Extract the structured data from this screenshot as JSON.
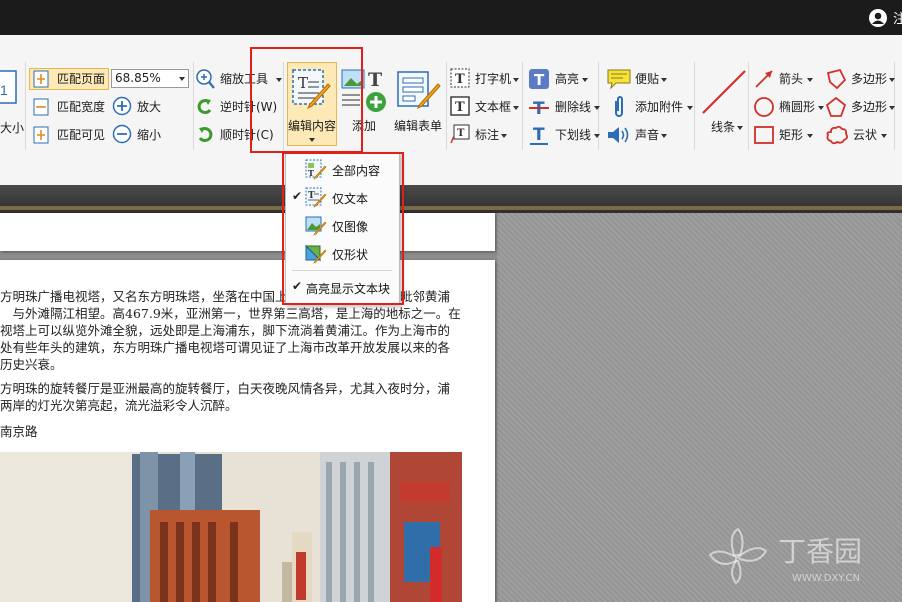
{
  "titlebar": {
    "user_text": "注"
  },
  "ribbon": {
    "fit_group": {
      "partial_label": "大小",
      "fit_page": "匹配页面",
      "fit_width": "匹配宽度",
      "fit_visible": "匹配可见",
      "zoom_value": "68.85%",
      "zoom_tool": "缩放工具",
      "zoom_in": "放大",
      "zoom_out": "缩小",
      "rotate_left": "逆时针(W)",
      "rotate_right": "顺时针(C)"
    },
    "edit_group": {
      "edit_content": "编辑内容",
      "add": "添加",
      "edit_form": "编辑表单"
    },
    "comment_group": {
      "typewriter": "打字机",
      "textbox": "文本框",
      "callout": "标注",
      "highlight": "高亮",
      "strikeout": "删除线",
      "underline": "下划线",
      "note": "便贴",
      "attach": "添加附件",
      "sound": "声音"
    },
    "shape_group": {
      "line": "线条",
      "arrow": "箭头",
      "ellipse": "椭圆形",
      "rectangle": "矩形",
      "polygon": "多边形",
      "polyline": "多边形",
      "cloud": "云状"
    }
  },
  "dropdown": {
    "items": [
      {
        "label": "全部内容",
        "checked": false
      },
      {
        "label": "仅文本",
        "checked": true
      },
      {
        "label": "仅图像",
        "checked": false
      },
      {
        "label": "仅形状",
        "checked": false
      },
      {
        "label": "高亮显示文本块",
        "checked": true
      }
    ]
  },
  "document": {
    "lines": [
      "方明珠广播电视塔，又名东方明珠塔，坐落在中国上海浦东新区陆家嘴，毗邻黄浦",
      "　与外滩隔江相望。高467.9米，亚洲第一，世界第三高塔，是上海的地标之一。在",
      "视塔上可以纵览外滩全貌，远处即是上海浦东，脚下流淌着黄浦江。作为上海市的",
      "处有些年头的建筑，东方明珠广播电视塔可谓见证了上海市改革开放发展以来的各",
      "历史兴衰。",
      "方明珠的旋转餐厅是亚洲最高的旋转餐厅，白天夜晚风情各异，尤其入夜时分，浦",
      "两岸的灯光次第亮起，流光溢彩令人沉醉。",
      "南京路"
    ]
  },
  "watermark": {
    "text": "丁香园",
    "sub": "WWW.DXY.CN"
  },
  "colors": {
    "highlight_box": "#e0201b",
    "accent_blue": "#2d6db5"
  }
}
